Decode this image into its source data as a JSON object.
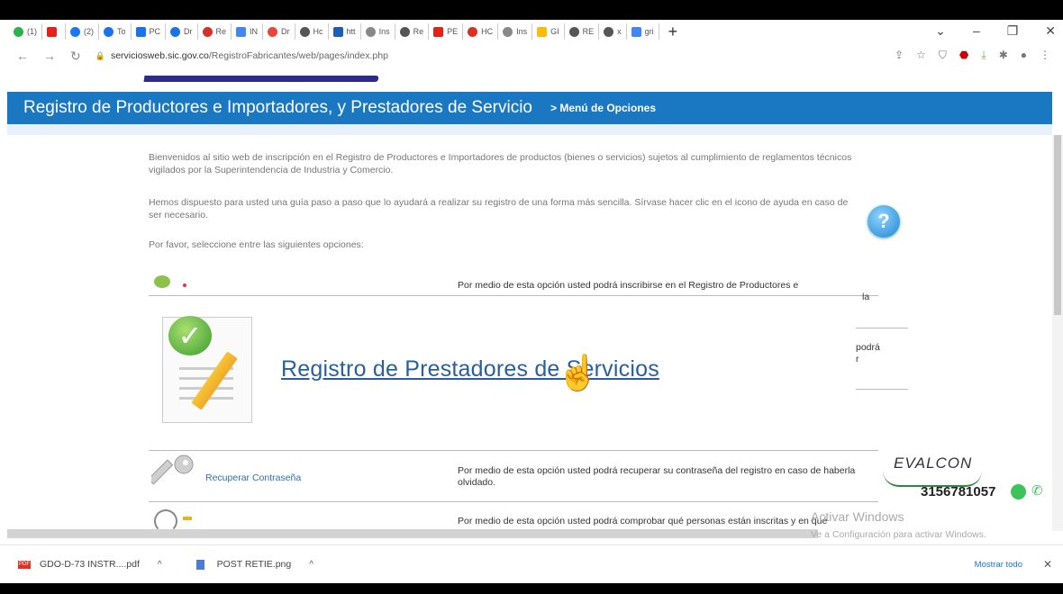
{
  "browser": {
    "tabs": [
      {
        "label": "(1)",
        "color": "#2bb24c"
      },
      {
        "label": "",
        "color": "#e62117"
      },
      {
        "label": "(2)",
        "color": "#1877f2"
      },
      {
        "label": "To",
        "color": "#1a73e8"
      },
      {
        "label": "PC",
        "color": "#1a73e8"
      },
      {
        "label": "Dr",
        "color": "#1a73e8"
      },
      {
        "label": "Re",
        "color": "#d93025"
      },
      {
        "label": "IN",
        "color": "#4285f4"
      },
      {
        "label": "Dr",
        "color": "#e8453c"
      },
      {
        "label": "Hc",
        "color": "#555555"
      },
      {
        "label": "htt",
        "color": "#1a5fb4"
      },
      {
        "label": "Ins",
        "color": "#888888"
      },
      {
        "label": "Re",
        "color": "#555555"
      },
      {
        "label": "PE",
        "color": "#e62117"
      },
      {
        "label": "HC",
        "color": "#d93025"
      },
      {
        "label": "Ins",
        "color": "#888888"
      },
      {
        "label": "GI",
        "color": "#fbbc04"
      },
      {
        "label": "RE",
        "color": "#555555"
      },
      {
        "label": "x",
        "color": "#555555"
      },
      {
        "label": "gri",
        "color": "#4285f4"
      }
    ],
    "new_tab": "+",
    "window_controls": [
      "⌄",
      "–",
      "❐",
      "✕"
    ],
    "url_host": "serviciosweb.sic.gov.co",
    "url_path": "/RegistroFabricantes/web/pages/index.php"
  },
  "site": {
    "title": "Registro de Productores e Importadores, y Prestadores de Servicio",
    "menu": "> Menú de Opciones",
    "intro1": "Bienvenidos al sitio web de inscripción en el Registro de Productores e Importadores de productos (bienes o servicios) sujetos al cumplimiento de reglamentos técnicos vigilados por la Superintendencia de Industria y Comercio.",
    "intro2": "Hemos dispuesto para usted una guía paso a paso que lo ayudará a realizar su registro de una forma más sencilla. Sírvase hacer clic en el icono de ayuda en caso de ser necesario.",
    "intro3": "Por favor, seleccione entre las siguientes opciones:",
    "help": "?",
    "option1_desc": "Por medio de esta opción usted podrá inscribirse en el Registro de Productores e",
    "option1_tail": "la",
    "zoom_link": "Registro de Prestadores de Servicios",
    "zoom_frag1": "podrá",
    "zoom_frag2": "r",
    "option3_link": "Recuperar Contraseña",
    "option3_desc": "Por medio de esta opción usted podrá recuperar su contraseña del registro en caso de haberla olvidado.",
    "option4_desc": "Por medio de esta opción usted podrá comprobar qué personas están inscritas y en qué"
  },
  "overlay": {
    "brand": "EVALCON",
    "phone": "3156781057",
    "activate_title": "Activar Windows",
    "activate_sub": "Ve a Configuración para activar Windows."
  },
  "downloads": {
    "items": [
      {
        "name": "GDO-D-73 INSTR....pdf",
        "type": "pdf"
      },
      {
        "name": "POST RETIE.png",
        "type": "png"
      }
    ],
    "show_all": "Mostrar todo",
    "close": "✕"
  }
}
